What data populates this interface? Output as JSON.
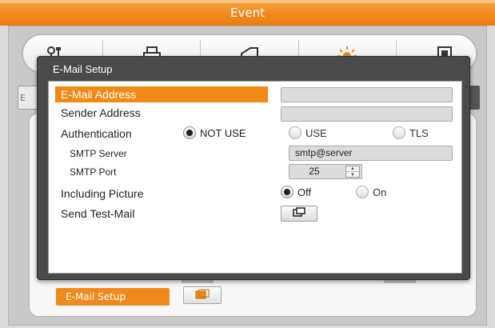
{
  "header": {
    "title": "Event"
  },
  "icon_tabs": [
    "tools-icon",
    "printer-icon",
    "network-icon",
    "sun-alarm-icon",
    "record-icon"
  ],
  "background": {
    "stub_left_text": "E",
    "email_setup_button": "E-Mail Setup",
    "email_setup_icon": "window-icon"
  },
  "dialog": {
    "title": "E-Mail Setup",
    "rows": {
      "email_address": {
        "label": "E-Mail Address",
        "value": ""
      },
      "sender_address": {
        "label": "Sender Address",
        "value": ""
      },
      "authentication": {
        "label": "Authentication",
        "options": [
          "NOT USE",
          "USE",
          "TLS"
        ],
        "selected": "NOT USE"
      },
      "smtp_server": {
        "label": "SMTP Server",
        "value": "smtp@server"
      },
      "smtp_port": {
        "label": "SMTP Port",
        "value": "25"
      },
      "including_picture": {
        "label": "Including Picture",
        "options": [
          "Off",
          "On"
        ],
        "selected": "Off"
      },
      "send_test_mail": {
        "label": "Send Test-Mail",
        "icon": "copy-window-icon"
      }
    }
  },
  "colors": {
    "accent": "#f08a1d",
    "dialog_frame": "#4a4a4a",
    "field_bg": "#dcdcdc"
  }
}
